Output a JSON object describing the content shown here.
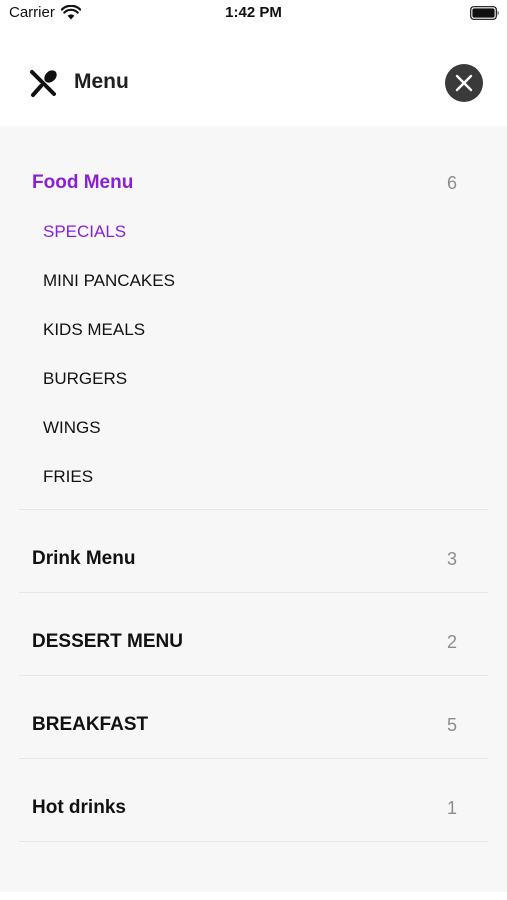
{
  "status_bar": {
    "carrier": "Carrier",
    "time": "1:42 PM"
  },
  "header": {
    "title": "Menu",
    "icon": "utensils-icon",
    "close_icon": "close-icon"
  },
  "colors": {
    "accent": "#8a1fd8",
    "close_bg": "#3a3a3a"
  },
  "categories": [
    {
      "title": "Food Menu",
      "count": "6",
      "expanded": true,
      "items": [
        "SPECIALS",
        "MINI PANCAKES",
        "KIDS MEALS",
        "BURGERS",
        "WINGS",
        "FRIES"
      ]
    },
    {
      "title": "Drink Menu",
      "count": "3"
    },
    {
      "title": "DESSERT MENU",
      "count": "2"
    },
    {
      "title": "BREAKFAST",
      "count": "5"
    },
    {
      "title": "Hot drinks",
      "count": "1"
    }
  ]
}
